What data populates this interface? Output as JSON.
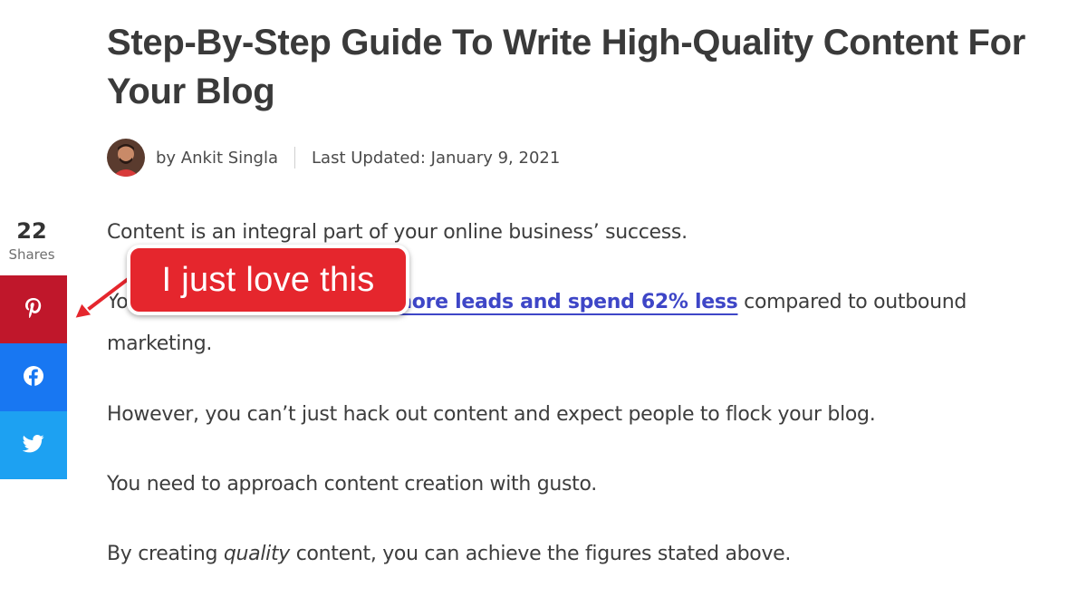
{
  "article": {
    "title": "Step-By-Step Guide To Write High-Quality Content For Your Blog",
    "author": "by Ankit Singla",
    "last_updated": "Last Updated: January 9, 2021"
  },
  "content": {
    "p1": "Content is an integral part of your online business’ success.",
    "p2_start": "Yo",
    "p2_link": "es more leads and spend 62% less",
    "p2_end": " compared to outbound",
    "p2_wrap": "marketing.",
    "p3": "However, you can’t just hack out content and expect people to flock your blog.",
    "p4": "You need to approach content creation with gusto.",
    "p5_pre": "By creating ",
    "p5_em": "quality",
    "p5_post": " content, you can achieve the figures stated above."
  },
  "share": {
    "count": "22",
    "label": "Shares",
    "buttons": [
      {
        "network": "pinterest",
        "icon": "pinterest-icon",
        "color": "#c0172b"
      },
      {
        "network": "facebook",
        "icon": "facebook-icon",
        "color": "#1877f2"
      },
      {
        "network": "twitter",
        "icon": "twitter-icon",
        "color": "#1da1f2"
      }
    ]
  },
  "annotation": {
    "text": "I just love this",
    "color": "#e5262d"
  },
  "colors": {
    "link": "#3e46c7",
    "title": "#3a3a3a"
  }
}
